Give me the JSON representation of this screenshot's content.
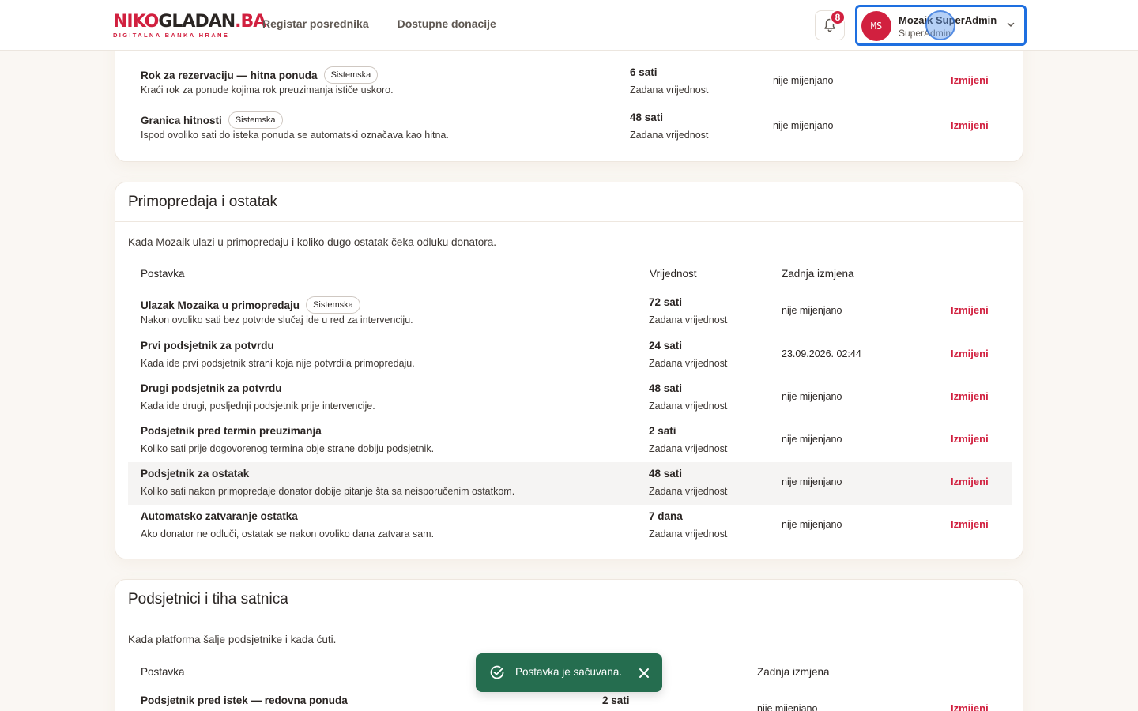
{
  "header": {
    "logo_main_red": "NIKO",
    "logo_main_dark": "GLADAN",
    "logo_main_red2": ".BA",
    "logo_sub": "DIGITALNA BANKA HRANE",
    "nav": [
      "Registar posrednika",
      "Dostupne donacije"
    ],
    "notifications": "8",
    "user": {
      "initials": "MS",
      "name": "Mozaik SuperAdmin",
      "role": "SuperAdmin"
    }
  },
  "section1": {
    "rows": [
      {
        "name": "Rok za rezervaciju — hitna ponuda",
        "tag": "Sistemska",
        "desc": "Kraći rok za ponude kojima rok preuzimanja ističe uskoro.",
        "value": "6 sati",
        "value_sub": "Zadana vrijednost",
        "changed": "nije mijenjano",
        "edit": "Izmijeni"
      },
      {
        "name": "Granica hitnosti",
        "tag": "Sistemska",
        "desc": "Ispod ovoliko sati do isteka ponuda se automatski označava kao hitna.",
        "value": "48 sati",
        "value_sub": "Zadana vrijednost",
        "changed": "nije mijenjano",
        "edit": "Izmijeni"
      }
    ]
  },
  "section2": {
    "title": "Primopredaja i ostatak",
    "desc": "Kada Mozaik ulazi u primopredaju i koliko dugo ostatak čeka odluku donatora.",
    "headers": {
      "setting": "Postavka",
      "value": "Vrijednost",
      "changed": "Zadnja izmjena"
    },
    "rows": [
      {
        "name": "Ulazak Mozaika u primopredaju",
        "tag": "Sistemska",
        "desc": "Nakon ovoliko sati bez potvrde slučaj ide u red za intervenciju.",
        "value": "72 sati",
        "value_sub": "Zadana vrijednost",
        "changed": "nije mijenjano",
        "edit": "Izmijeni"
      },
      {
        "name": "Prvi podsjetnik za potvrdu",
        "tag": "",
        "desc": "Kada ide prvi podsjetnik strani koja nije potvrdila primopredaju.",
        "value": "24 sati",
        "value_sub": "Zadana vrijednost",
        "changed": "23.09.2026. 02:44",
        "edit": "Izmijeni"
      },
      {
        "name": "Drugi podsjetnik za potvrdu",
        "tag": "",
        "desc": "Kada ide drugi, posljednji podsjetnik prije intervencije.",
        "value": "48 sati",
        "value_sub": "Zadana vrijednost",
        "changed": "nije mijenjano",
        "edit": "Izmijeni"
      },
      {
        "name": "Podsjetnik pred termin preuzimanja",
        "tag": "",
        "desc": "Koliko sati prije dogovorenog termina obje strane dobiju podsjetnik.",
        "value": "2 sati",
        "value_sub": "Zadana vrijednost",
        "changed": "nije mijenjano",
        "edit": "Izmijeni"
      },
      {
        "name": "Podsjetnik za ostatak",
        "tag": "",
        "desc": "Koliko sati nakon primopredaje donator dobije pitanje šta sa neisporučenim ostatkom.",
        "value": "48 sati",
        "value_sub": "Zadana vrijednost",
        "changed": "nije mijenjano",
        "edit": "Izmijeni"
      },
      {
        "name": "Automatsko zatvaranje ostatka",
        "tag": "",
        "desc": "Ako donator ne odluči, ostatak se nakon ovoliko dana zatvara sam.",
        "value": "7 dana",
        "value_sub": "Zadana vrijednost",
        "changed": "nije mijenjano",
        "edit": "Izmijeni"
      }
    ]
  },
  "section3": {
    "title": "Podsjetnici i tiha satnica",
    "desc": "Kada platforma šalje podsjetnike i kada ćuti.",
    "headers": {
      "setting": "Postavka",
      "changed": "Zadnja izmjena"
    },
    "rows": [
      {
        "name": "Podsjetnik pred istek — redovna ponuda",
        "value": "2 sati",
        "changed": "nije mijenjano",
        "edit": "Izmijeni"
      }
    ]
  },
  "toast": {
    "text": "Postavka je sačuvana."
  },
  "colors": {
    "brand": "#d1203f",
    "focus": "#1e6fe0",
    "toast": "#256d4f"
  }
}
